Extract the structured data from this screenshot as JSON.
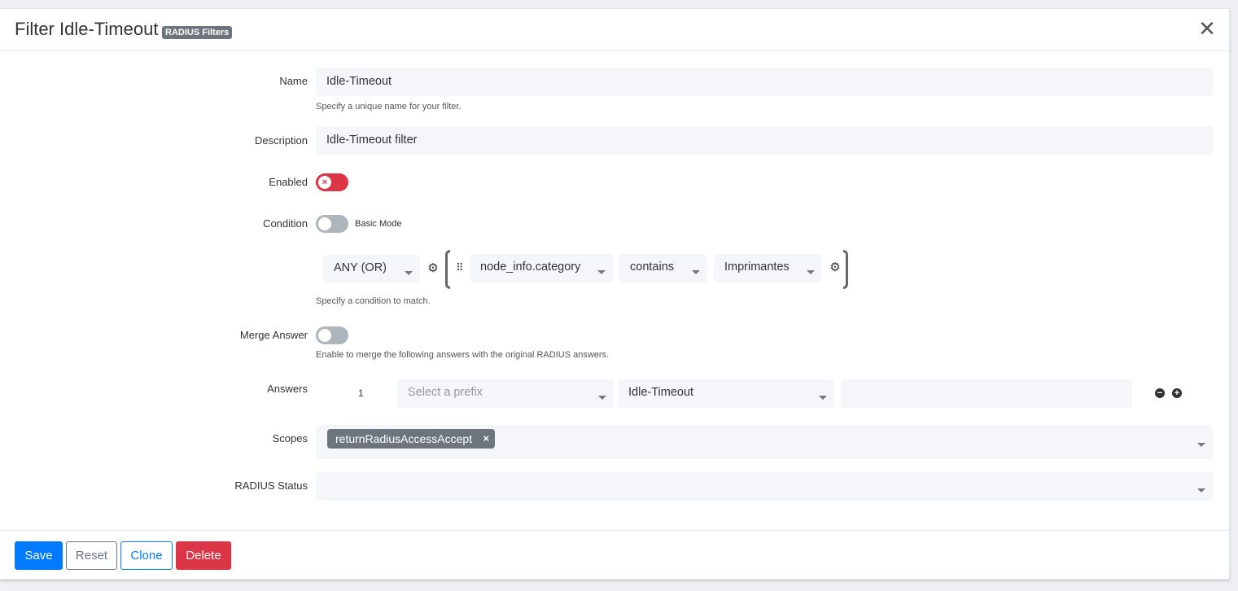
{
  "header": {
    "title": "Filter Idle-Timeout",
    "badge": "RADIUS Filters",
    "close_symbol": "✕"
  },
  "form": {
    "name": {
      "label": "Name",
      "value": "Idle-Timeout",
      "help": "Specify a unique name for your filter."
    },
    "description": {
      "label": "Description",
      "value": "Idle-Timeout filter"
    },
    "enabled": {
      "label": "Enabled",
      "state": "off"
    },
    "condition": {
      "label": "Condition",
      "mode_label": "Basic Mode",
      "operator": "ANY (OR)",
      "rule": {
        "field": "node_info.category",
        "op": "contains",
        "value": "Imprimantes"
      },
      "help": "Specify a condition to match."
    },
    "merge_answer": {
      "label": "Merge Answer",
      "help": "Enable to merge the following answers with the original RADIUS answers."
    },
    "answers": {
      "label": "Answers",
      "rows": [
        {
          "index": "1",
          "prefix_placeholder": "Select a prefix",
          "attribute": "Idle-Timeout",
          "value": ""
        }
      ]
    },
    "scopes": {
      "label": "Scopes",
      "tags": [
        "returnRadiusAccessAccept"
      ]
    },
    "radius_status": {
      "label": "RADIUS Status",
      "value": ""
    }
  },
  "footer": {
    "save": "Save",
    "reset": "Reset",
    "clone": "Clone",
    "delete": "Delete"
  },
  "colors": {
    "primary": "#007bff",
    "danger": "#dc3545",
    "secondary": "#6c757d",
    "input_bg": "#f4f6f9"
  }
}
